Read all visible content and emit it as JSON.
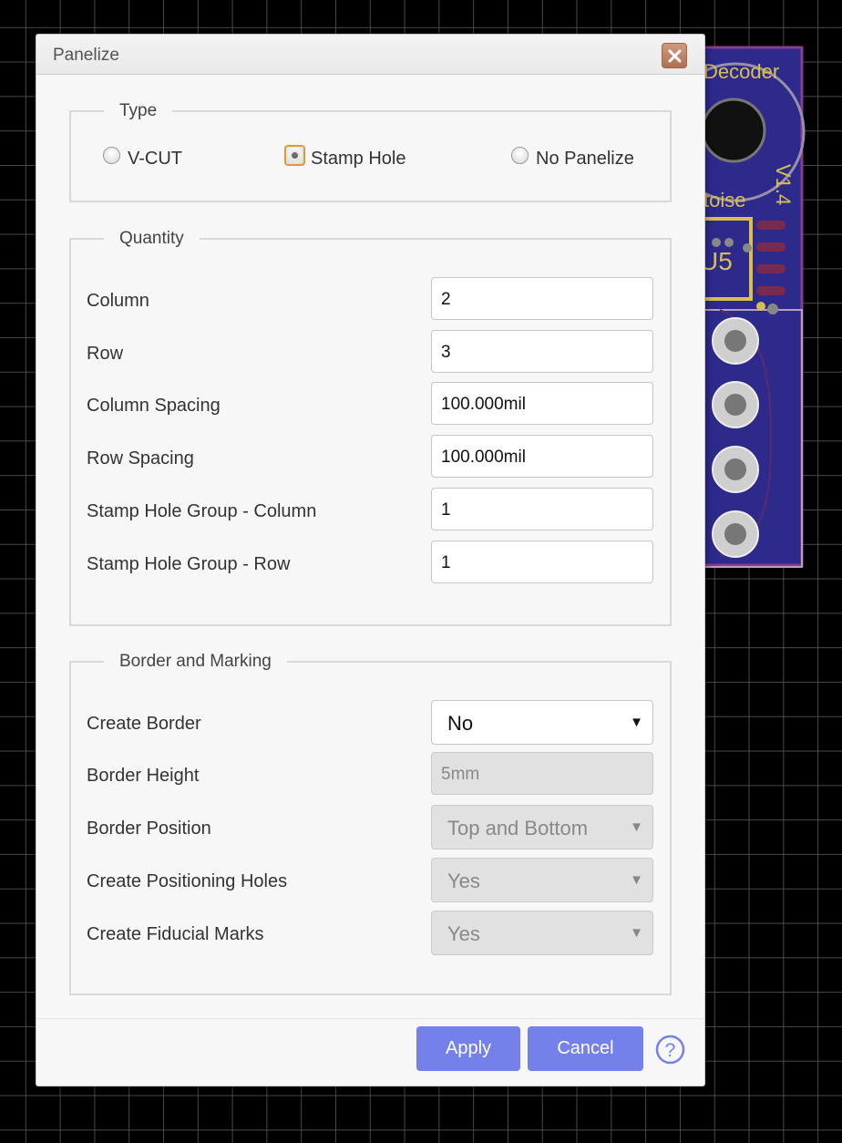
{
  "canvas": {
    "silkscreen_decoder": "Decoder",
    "silkscreen_toise": "toise",
    "silkscreen_u5": "U5",
    "silkscreen_version": "V1.4"
  },
  "dialog": {
    "title": "Panelize",
    "type_section": {
      "legend": "Type",
      "options": [
        "V-CUT",
        "Stamp Hole",
        "No Panelize"
      ],
      "selected": "Stamp Hole"
    },
    "quantity_section": {
      "legend": "Quantity",
      "fields": [
        {
          "label": "Column",
          "value": "2"
        },
        {
          "label": "Row",
          "value": "3"
        },
        {
          "label": "Column Spacing",
          "value": "100.000mil"
        },
        {
          "label": "Row Spacing",
          "value": "100.000mil"
        },
        {
          "label": "Stamp Hole Group - Column",
          "value": "1"
        },
        {
          "label": "Stamp Hole Group - Row",
          "value": "1"
        }
      ]
    },
    "border_section": {
      "legend": "Border and Marking",
      "create_border": {
        "label": "Create Border",
        "value": "No"
      },
      "border_height": {
        "label": "Border Height",
        "value": "5mm"
      },
      "border_position": {
        "label": "Border Position",
        "value": "Top and Bottom"
      },
      "positioning_holes": {
        "label": "Create Positioning Holes",
        "value": "Yes"
      },
      "fiducial_marks": {
        "label": "Create Fiducial Marks",
        "value": "Yes"
      }
    },
    "buttons": {
      "apply": "Apply",
      "cancel": "Cancel",
      "help": "?"
    }
  },
  "colors": {
    "accent": "#7581ea",
    "pcb_board": "#2d2a8c",
    "silkscreen": "#d8c050",
    "outline": "#8a3b8e"
  }
}
